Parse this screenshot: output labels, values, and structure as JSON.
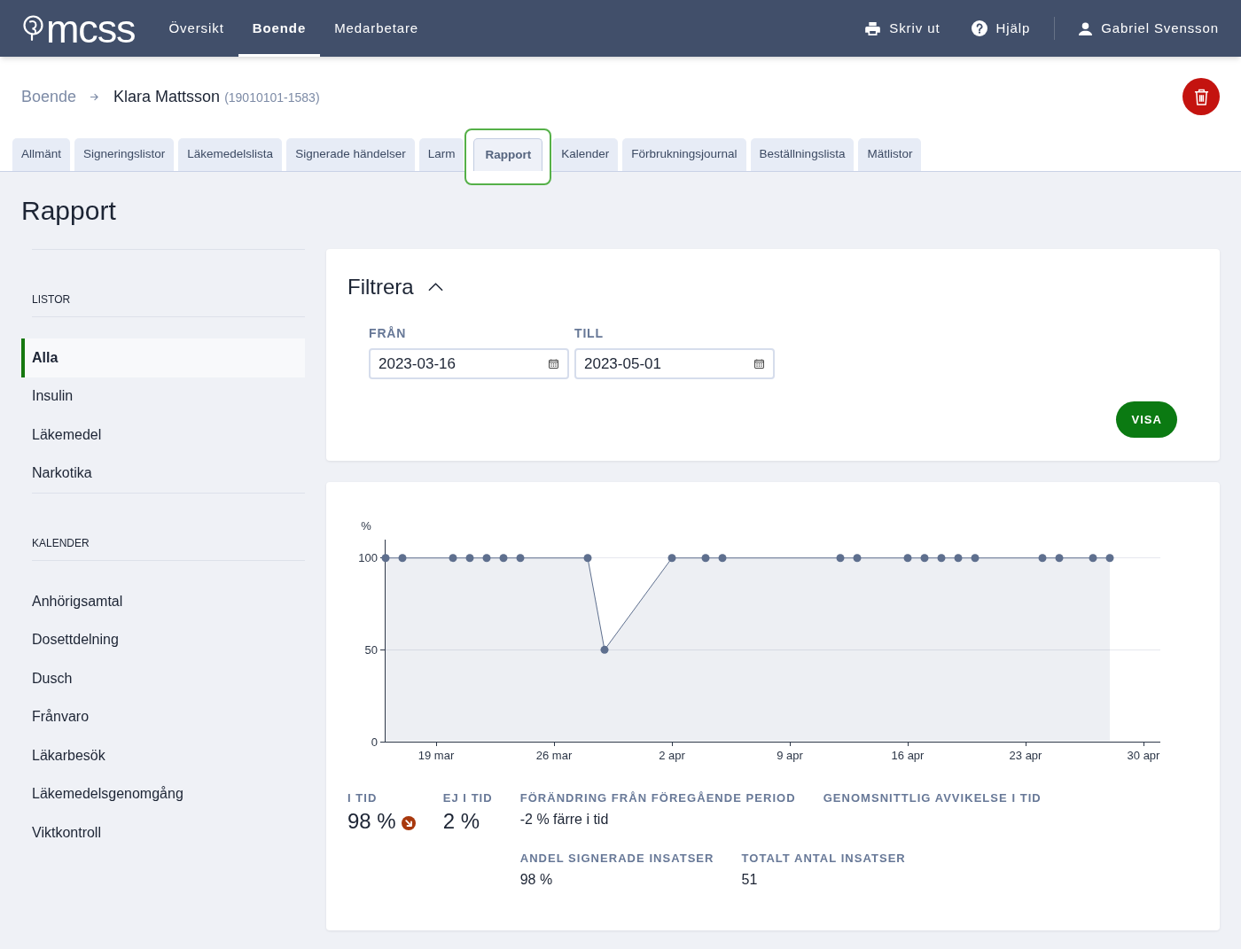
{
  "header": {
    "logo": "mcss",
    "nav": [
      {
        "label": "Översikt",
        "selected": false
      },
      {
        "label": "Boende",
        "selected": true
      },
      {
        "label": "Medarbetare",
        "selected": false
      }
    ],
    "actions": [
      {
        "kind": "print",
        "label": "Skriv ut"
      },
      {
        "kind": "help",
        "label": "Hjälp"
      }
    ],
    "user": {
      "name": "Gabriel Svensson"
    }
  },
  "breadcrumb": {
    "parent": "Boende",
    "current": "Klara Mattsson",
    "personal_number": "(19010101-1583)"
  },
  "tabs": [
    {
      "label": "Allmänt",
      "selected": false,
      "focused": false
    },
    {
      "label": "Signeringslistor",
      "selected": false,
      "focused": false
    },
    {
      "label": "Läkemedelslista",
      "selected": false,
      "focused": false
    },
    {
      "label": "Signerade händelser",
      "selected": false,
      "focused": false
    },
    {
      "label": "Larm",
      "selected": false,
      "focused": false
    },
    {
      "label": "Rapport",
      "selected": true,
      "focused": true
    },
    {
      "label": "Kalender",
      "selected": false,
      "focused": false
    },
    {
      "label": "Förbrukningsjournal",
      "selected": false,
      "focused": false
    },
    {
      "label": "Beställningslista",
      "selected": false,
      "focused": false
    },
    {
      "label": "Mätlistor",
      "selected": false,
      "focused": false
    }
  ],
  "page_title": "Rapport",
  "sidebar": {
    "sections": [
      {
        "title": "LISTOR",
        "items": [
          {
            "label": "Alla",
            "selected": true
          },
          {
            "label": "Insulin",
            "selected": false
          },
          {
            "label": "Läkemedel",
            "selected": false
          },
          {
            "label": "Narkotika",
            "selected": false
          }
        ]
      },
      {
        "title": "KALENDER",
        "items": [
          {
            "label": "Anhörigsamtal",
            "selected": false
          },
          {
            "label": "Dosettdelning",
            "selected": false
          },
          {
            "label": "Dusch",
            "selected": false
          },
          {
            "label": "Frånvaro",
            "selected": false
          },
          {
            "label": "Läkarbesök",
            "selected": false
          },
          {
            "label": "Läkemedelsgenomgång",
            "selected": false
          },
          {
            "label": "Viktkontroll",
            "selected": false
          }
        ]
      }
    ]
  },
  "filter": {
    "title": "Filtrera",
    "expanded": true,
    "fields": [
      {
        "label": "FRÅN",
        "value": "2023-03-16"
      },
      {
        "label": "TILL",
        "value": "2023-05-01"
      }
    ],
    "button": "VISA"
  },
  "report": {
    "chart_data": {
      "type": "line",
      "ylabel": "%",
      "x": [
        "2023-03-16",
        "2023-03-17",
        "2023-03-20",
        "2023-03-21",
        "2023-03-22",
        "2023-03-23",
        "2023-03-24",
        "2023-03-28",
        "2023-03-29",
        "2023-04-02",
        "2023-04-04",
        "2023-04-05",
        "2023-04-12",
        "2023-04-13",
        "2023-04-16",
        "2023-04-17",
        "2023-04-18",
        "2023-04-19",
        "2023-04-20",
        "2023-04-24",
        "2023-04-25",
        "2023-04-27",
        "2023-04-28"
      ],
      "series": [
        {
          "color": "#5e6f8e",
          "marker": "circle",
          "values": [
            100,
            100,
            100,
            100,
            100,
            100,
            100,
            100,
            50,
            100,
            100,
            100,
            100,
            100,
            100,
            100,
            100,
            100,
            100,
            100,
            100,
            100,
            100
          ]
        }
      ],
      "xlim": [
        "2023-03-16",
        "2023-05-01"
      ],
      "ylim": [
        0,
        110
      ],
      "xticks": [
        {
          "value": "2023-03-19",
          "label": "19 mar"
        },
        {
          "value": "2023-03-26",
          "label": "26 mar"
        },
        {
          "value": "2023-04-02",
          "label": "2 apr"
        },
        {
          "value": "2023-04-09",
          "label": "9 apr"
        },
        {
          "value": "2023-04-16",
          "label": "16 apr"
        },
        {
          "value": "2023-04-23",
          "label": "23 apr"
        },
        {
          "value": "2023-04-30",
          "label": "30 apr"
        }
      ],
      "yticks": [
        0,
        50,
        100
      ]
    },
    "stats": [
      {
        "kind": "large",
        "label": "I TID",
        "value": "98 %",
        "decreased": true
      },
      {
        "kind": "large",
        "label": "EJ I TID",
        "value": "2 %"
      },
      {
        "kind": "small",
        "label": "FÖRÄNDRING FRÅN FÖREGÅENDE PERIOD",
        "value": "-2 % färre i tid"
      },
      {
        "kind": "small",
        "label": "GENOMSNITTLIG AVVIKELSE I TID"
      },
      {
        "kind": "small",
        "label": "ANDEL SIGNERADE INSATSER",
        "value": "98 %"
      },
      {
        "kind": "small",
        "label": "TOTALT ANTAL INSATSER",
        "value": "51"
      }
    ]
  }
}
